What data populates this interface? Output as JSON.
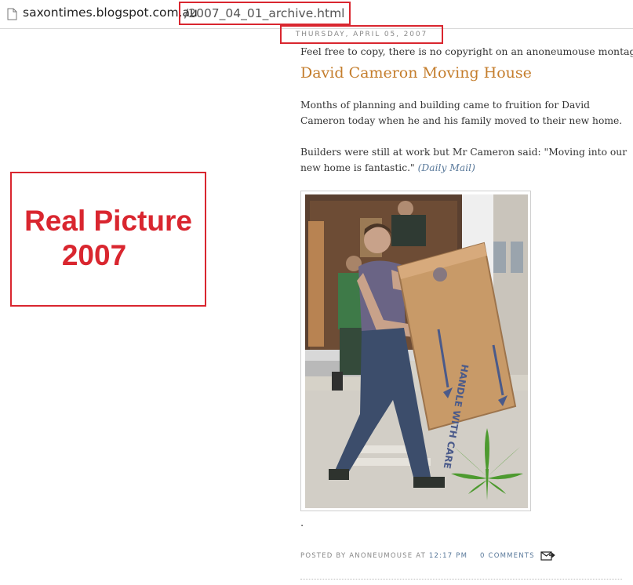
{
  "browser": {
    "url_domain": "saxontimes.blogspot.com.au",
    "url_path": "/2007_04_01_archive.html",
    "page_icon": "document-icon"
  },
  "post": {
    "date": "THURSDAY, APRIL 05, 2007",
    "tagline": "Feel free to copy, there is no copyright on an anoneumouse montage.",
    "title": "David Cameron Moving House",
    "paragraph1": "Months of planning and building came to fruition for David Cameron today when he and his family moved to their new home.",
    "paragraph2": "Builders were still at work but Mr Cameron said: \"Moving into our new home is fantastic.\"",
    "source_link": "(Daily Mail)",
    "image_alt": "Man carrying a large cardboard box labelled HANDLE WITH CARE from a removal van",
    "box_text": "HANDLE WITH CARE",
    "trailing_dot": ".",
    "footer": {
      "posted_by": "POSTED BY ANONEUMOUSE AT",
      "time": "12:17 PM",
      "comments": "0 COMMENTS",
      "email_icon": "email-post-icon"
    }
  },
  "annotation": {
    "line1": "Real Picture",
    "line2": "2007",
    "color": "#d9262f"
  },
  "colors": {
    "title": "#c47d2c",
    "link": "#58789a",
    "annotation_red": "#d9262f"
  }
}
